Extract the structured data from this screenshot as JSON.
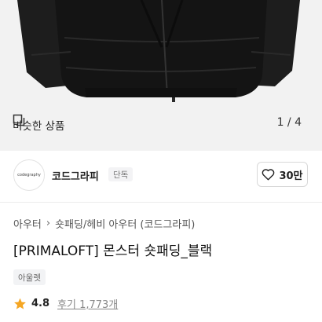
{
  "gallery": {
    "similar_label": "비슷한 상품",
    "similar_icon": "similar-items-icon",
    "page_indicator": "1 / 4"
  },
  "brand": {
    "logo_text": "codegraphy",
    "name": "코드그라피",
    "badge": "단독",
    "like_icon": "heart-icon",
    "like_count": "30만"
  },
  "breadcrumb": {
    "items": [
      "아우터",
      "숏패딩/헤비 아우터 (코드그라피)"
    ],
    "separator": "›"
  },
  "product": {
    "title": "[PRIMALOFT] 몬스터 숏패딩_블랙",
    "tag": "아울렛"
  },
  "rating": {
    "star_icon": "star-icon",
    "score": "4.8",
    "reviews_label": "후기 1,773개",
    "star_color": "#f5a623"
  }
}
